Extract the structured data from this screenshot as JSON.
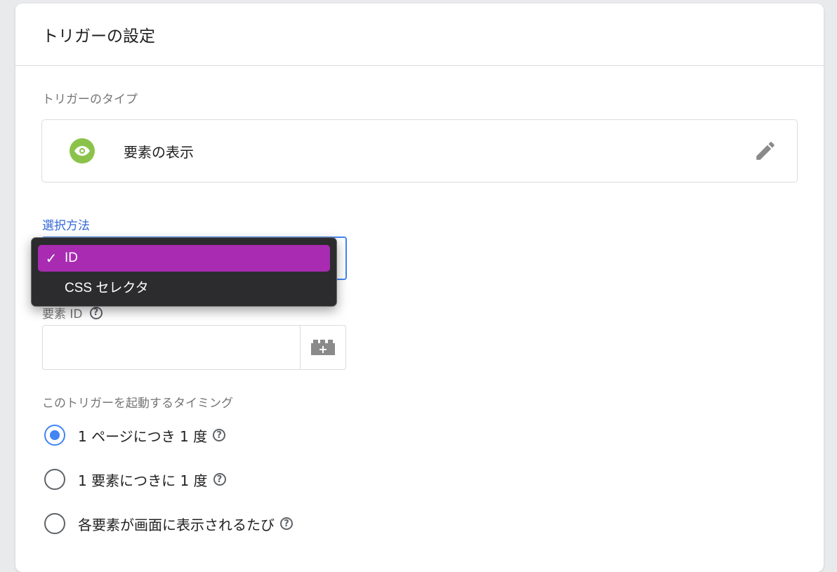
{
  "header": {
    "title": "トリガーの設定"
  },
  "trigger_type": {
    "label": "トリガーのタイプ",
    "name": "要素の表示",
    "icon": "eye-icon",
    "icon_color": "#8bc34a"
  },
  "selection_method": {
    "label": "選択方法",
    "options": [
      {
        "label": "ID",
        "selected": true
      },
      {
        "label": "CSS セレクタ",
        "selected": false
      }
    ],
    "check_mark": "✓"
  },
  "element_id": {
    "label": "要素 ID",
    "help": "?",
    "value": "",
    "variable_button_icon": "variable-building-block-icon"
  },
  "timing": {
    "label": "このトリガーを起動するタイミング",
    "options": [
      {
        "label": "1 ページにつき 1 度",
        "checked": true
      },
      {
        "label": "1 要素につきに 1 度",
        "checked": false
      },
      {
        "label": "各要素が画面に表示されるたび",
        "checked": false
      }
    ],
    "help": "?"
  },
  "colors": {
    "accent": "#4285f4",
    "dropdown_highlight": "#a82bb2",
    "dropdown_bg": "#2c2c2e"
  }
}
